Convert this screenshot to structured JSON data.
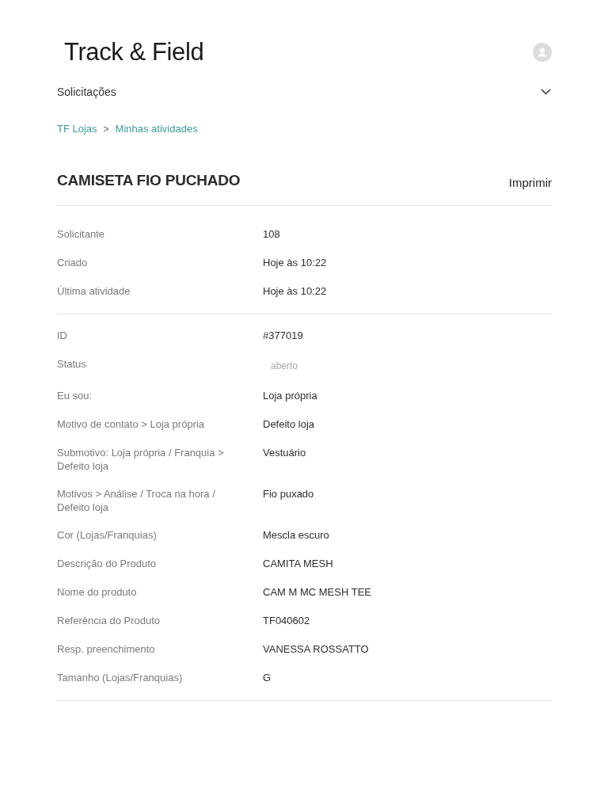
{
  "header": {
    "logo": "Track & Field"
  },
  "nav": {
    "label": "Solicitações",
    "expanded": false
  },
  "breadcrumbs": {
    "separator": ">",
    "items": [
      {
        "label": "TF Lojas"
      },
      {
        "label": "Minhas atividades"
      }
    ]
  },
  "request": {
    "title": "CAMISETA FIO PUCHADO",
    "print_label": "Imprimir"
  },
  "sections": [
    {
      "fields": [
        {
          "kind": "text",
          "label": "Solicitante",
          "value": "108"
        },
        {
          "kind": "text",
          "label": "Criado",
          "value": "Hoje às 10:22"
        },
        {
          "kind": "text",
          "label": "Última atividade",
          "value": "Hoje às 10:22"
        }
      ]
    },
    {
      "fields": [
        {
          "kind": "text",
          "label": "ID",
          "value": "#377019"
        },
        {
          "kind": "status",
          "label": "Status",
          "value": "aberto"
        },
        {
          "kind": "text",
          "label": "Eu sou:",
          "value": "Loja própria"
        },
        {
          "kind": "text",
          "label": "Motivo de contato > Loja própria",
          "value": "Defeito loja"
        },
        {
          "kind": "text",
          "label": "Submotivo: Loja própria / Franquia > Defeito loja",
          "value": "Vestuário"
        },
        {
          "kind": "text",
          "label": "Motivos > Análise / Troca na hora / Defeito loja",
          "value": "Fio puxado"
        },
        {
          "kind": "text",
          "label": "Cor (Lojas/Franquias)",
          "value": "Mescla escuro"
        },
        {
          "kind": "text",
          "label": "Descrição do Produto",
          "value": "CAMITA MESH"
        },
        {
          "kind": "text",
          "label": "Nome do produto",
          "value": "CAM M MC MESH TEE"
        },
        {
          "kind": "text",
          "label": "Referência do Produto",
          "value": "TF040602"
        },
        {
          "kind": "text",
          "label": "Resp. preenchimento",
          "value": "VANESSA ROSSATTO"
        },
        {
          "kind": "text",
          "label": "Tamanho (Lojas/Franquias)",
          "value": "G"
        }
      ]
    }
  ]
}
